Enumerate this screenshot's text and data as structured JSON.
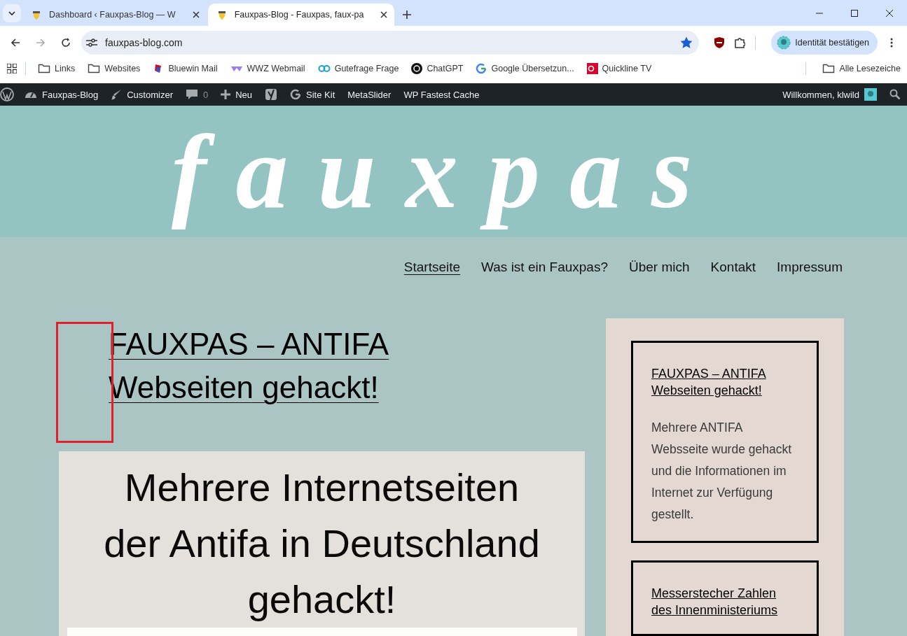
{
  "browser": {
    "tabs": [
      {
        "title": "Dashboard ‹ Fauxpas-Blog — W",
        "selected": false
      },
      {
        "title": "Fauxpas-Blog - Fauxpas, faux-pa",
        "selected": true
      }
    ],
    "address": "fauxpas-blog.com",
    "bookmarked": true,
    "profile_button": "Identität bestätigen",
    "bookmarks": [
      {
        "label": "Links",
        "kind": "folder"
      },
      {
        "label": "Websites",
        "kind": "folder"
      },
      {
        "label": "Bluewin Mail",
        "kind": "bluewin"
      },
      {
        "label": "WWZ Webmail",
        "kind": "wwz"
      },
      {
        "label": "Gutefrage Frage",
        "kind": "gutefrage"
      },
      {
        "label": "ChatGPT",
        "kind": "chatgpt"
      },
      {
        "label": "Google Übersetzun...",
        "kind": "google"
      },
      {
        "label": "Quickline TV",
        "kind": "quickline"
      }
    ],
    "all_bookmarks": "Alle Lesezeiche"
  },
  "admin_bar": {
    "items": [
      {
        "label": "Fauxpas-Blog",
        "kind": "dashboard"
      },
      {
        "label": "Customizer",
        "kind": "brush"
      },
      {
        "label": "0",
        "kind": "comments"
      },
      {
        "label": "Neu",
        "kind": "new"
      },
      {
        "kind": "yoast"
      },
      {
        "label": "Site Kit",
        "kind": "google"
      },
      {
        "label": "MetaSlider",
        "kind": "plain"
      },
      {
        "label": "WP Fastest Cache",
        "kind": "plain"
      }
    ],
    "greeting": "Willkommen, klwild"
  },
  "site": {
    "logo": "fauxpas",
    "nav": [
      {
        "label": "Startseite",
        "selected": true
      },
      {
        "label": "Was ist ein Fauxpas?",
        "selected": false
      },
      {
        "label": "Über mich",
        "selected": false
      },
      {
        "label": "Kontakt",
        "selected": false
      },
      {
        "label": "Impressum",
        "selected": false
      }
    ],
    "post_title": "FAUXPAS – ANTIFA Webseiten gehackt!",
    "featured_image_text": "Mehrere Internetseiten der Antifa in Deutschland gehackt!",
    "sidebar": [
      {
        "title": "FAUXPAS – ANTIFA Webseiten gehackt!",
        "excerpt": "Mehrere ANTIFA Websseite wurde gehackt und die Informationen im Internet zur Verfügung gestellt."
      },
      {
        "title": "Messerstecher Zahlen des Innenministeriums"
      }
    ]
  }
}
